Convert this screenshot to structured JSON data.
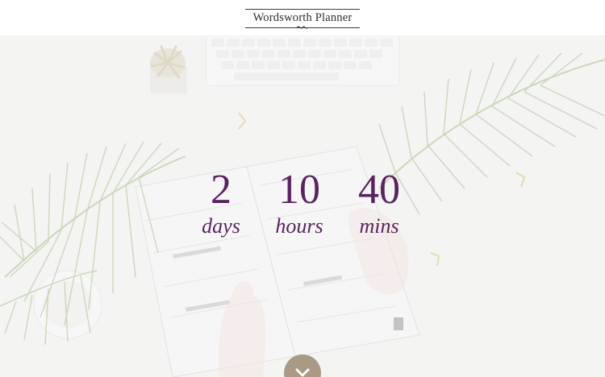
{
  "header": {
    "logo_text": "Wordsworth Planner"
  },
  "countdown": {
    "days": {
      "value": "2",
      "label": "days"
    },
    "hours": {
      "value": "10",
      "label": "hours"
    },
    "mins": {
      "value": "40",
      "label": "mins"
    }
  },
  "colors": {
    "accent": "#5a2360",
    "button": "#a89a84",
    "background": "#f4f4f3"
  },
  "scroll_button": {
    "icon": "chevron-down-icon"
  }
}
